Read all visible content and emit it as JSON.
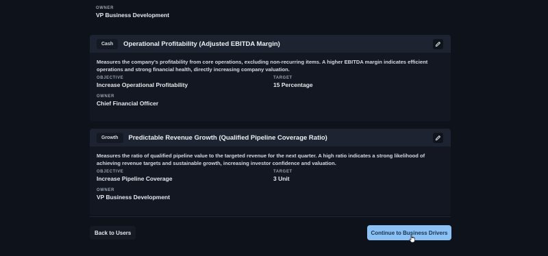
{
  "top_section": {
    "owner_label": "OWNER",
    "owner_value": "VP Business Development"
  },
  "cards": [
    {
      "tag": "Cash",
      "title": "Operational Profitability (Adjusted EBITDA Margin)",
      "description": "Measures the company's profitability from core operations, excluding non-recurring items. A higher EBITDA margin indicates efficient operations and strong financial health, directly increasing company valuation.",
      "objective_label": "OBJECTIVE",
      "objective_value": "Increase Operational Profitability",
      "target_label": "TARGET",
      "target_value": "15 Percentage",
      "owner_label": "OWNER",
      "owner_value": "Chief Financial Officer"
    },
    {
      "tag": "Growth",
      "title": "Predictable Revenue Growth (Qualified Pipeline Coverage Ratio)",
      "description": "Measures the ratio of qualified pipeline value to the targeted revenue for the next quarter. A high ratio indicates a strong likelihood of achieving revenue targets and sustainable growth, increasing investor confidence and valuation.",
      "objective_label": "OBJECTIVE",
      "objective_value": "Increase Pipeline Coverage",
      "target_label": "TARGET",
      "target_value": "3 Unit",
      "owner_label": "OWNER",
      "owner_value": "VP Business Development"
    }
  ],
  "footer": {
    "back_label": "Back to Users",
    "continue_label": "Continue to Business Drivers"
  },
  "icons": {
    "edit": "pencil-icon",
    "cursor": "pointer-cursor-icon"
  },
  "colors": {
    "background": "#0e121a",
    "card_header": "#1d2330",
    "primary_button": "#8cc1f5"
  }
}
